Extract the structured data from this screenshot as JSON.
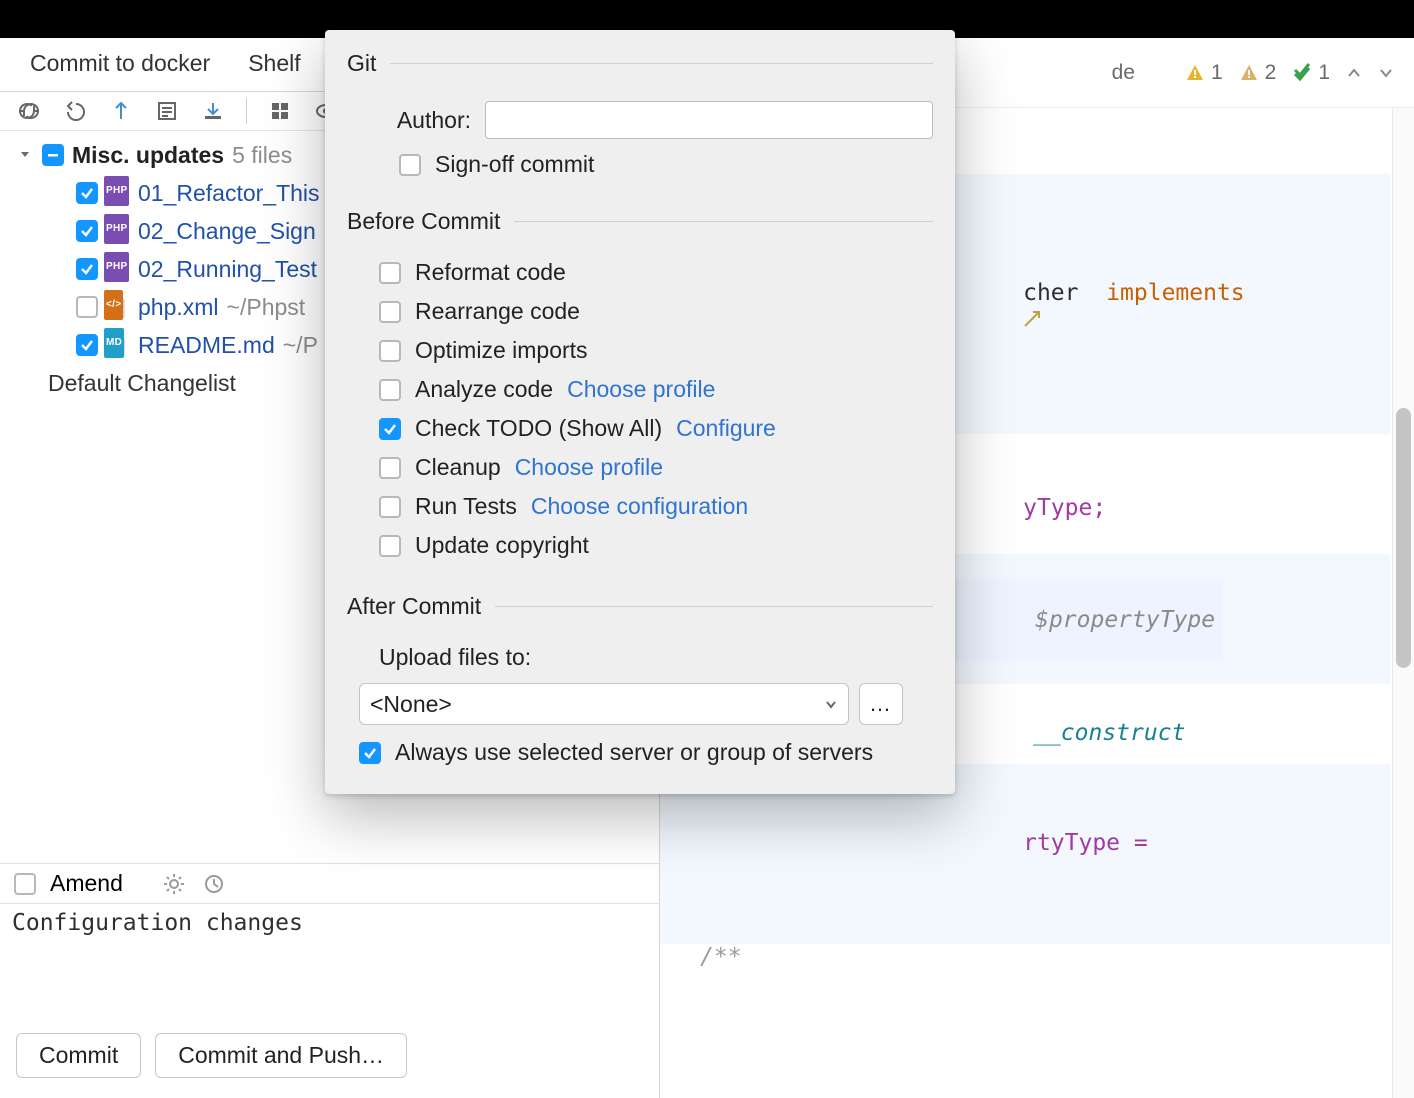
{
  "tabs": {
    "commit": "Commit to docker",
    "shelf": "Shelf"
  },
  "tree": {
    "group_name": "Misc. updates",
    "group_count": "5 files",
    "files": [
      {
        "name": "01_Refactor_This",
        "badge": "PHP",
        "checked": true,
        "path": ""
      },
      {
        "name": "02_Change_Sign",
        "badge": "PHP",
        "checked": true,
        "path": ""
      },
      {
        "name": "02_Running_Test",
        "badge": "PHP",
        "checked": true,
        "path": ""
      },
      {
        "name": "php.xml",
        "badge": "XML",
        "checked": false,
        "path": "~/Phpst"
      },
      {
        "name": "README.md",
        "badge": "MD",
        "checked": true,
        "path": "~/P"
      }
    ],
    "default_changelist": "Default Changelist"
  },
  "amend": {
    "label": "Amend"
  },
  "commit_message": "Configuration changes",
  "buttons": {
    "commit": "Commit",
    "commit_push": "Commit and Push…"
  },
  "popover": {
    "git_title": "Git",
    "author_label": "Author:",
    "signoff": "Sign-off commit",
    "before_title": "Before Commit",
    "opts": {
      "reformat": "Reformat code",
      "rearrange": "Rearrange code",
      "optimize": "Optimize imports",
      "analyze": "Analyze code",
      "analyze_link": "Choose profile",
      "todo": "Check TODO (Show All)",
      "todo_link": "Configure",
      "cleanup": "Cleanup",
      "cleanup_link": "Choose profile",
      "run_tests": "Run Tests",
      "run_tests_link": "Choose configuration",
      "copyright": "Update copyright"
    },
    "after_title": "After Commit",
    "upload_label": "Upload files to:",
    "upload_value": "<None>",
    "always_use": "Always use selected server or group of servers"
  },
  "editor": {
    "status": {
      "de_label": "de",
      "warn1": "1",
      "warn2": "2",
      "ok": "1"
    },
    "tokens": {
      "cher": "cher",
      "implements": "implements",
      "yType": "yType;",
      "propertyType": "$propertyType",
      "construct": "__construct",
      "rtyTypeAssign": "rtyType =",
      "doc": "/**"
    }
  }
}
